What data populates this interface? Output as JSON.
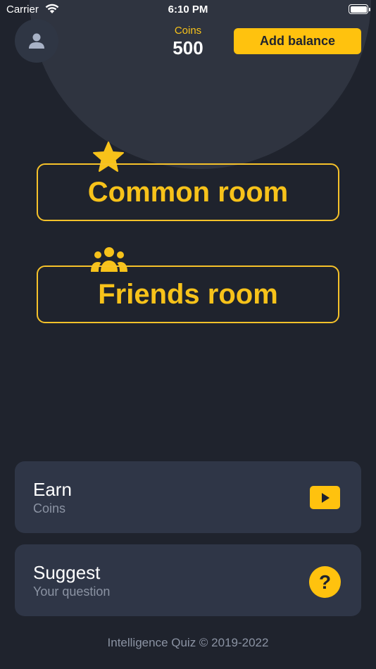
{
  "status": {
    "carrier": "Carrier",
    "time": "6:10 PM"
  },
  "header": {
    "coins_label": "Coins",
    "coins_value": "500",
    "add_balance_label": "Add balance"
  },
  "rooms": {
    "common": "Common room",
    "friends": "Friends room"
  },
  "cards": {
    "earn": {
      "title": "Earn",
      "subtitle": "Coins"
    },
    "suggest": {
      "title": "Suggest",
      "subtitle": "Your question",
      "icon_text": "?"
    }
  },
  "footer": "Intelligence Quiz © 2019-2022",
  "colors": {
    "accent": "#ffc20e",
    "background": "#1f232d",
    "card": "#2f3647"
  }
}
